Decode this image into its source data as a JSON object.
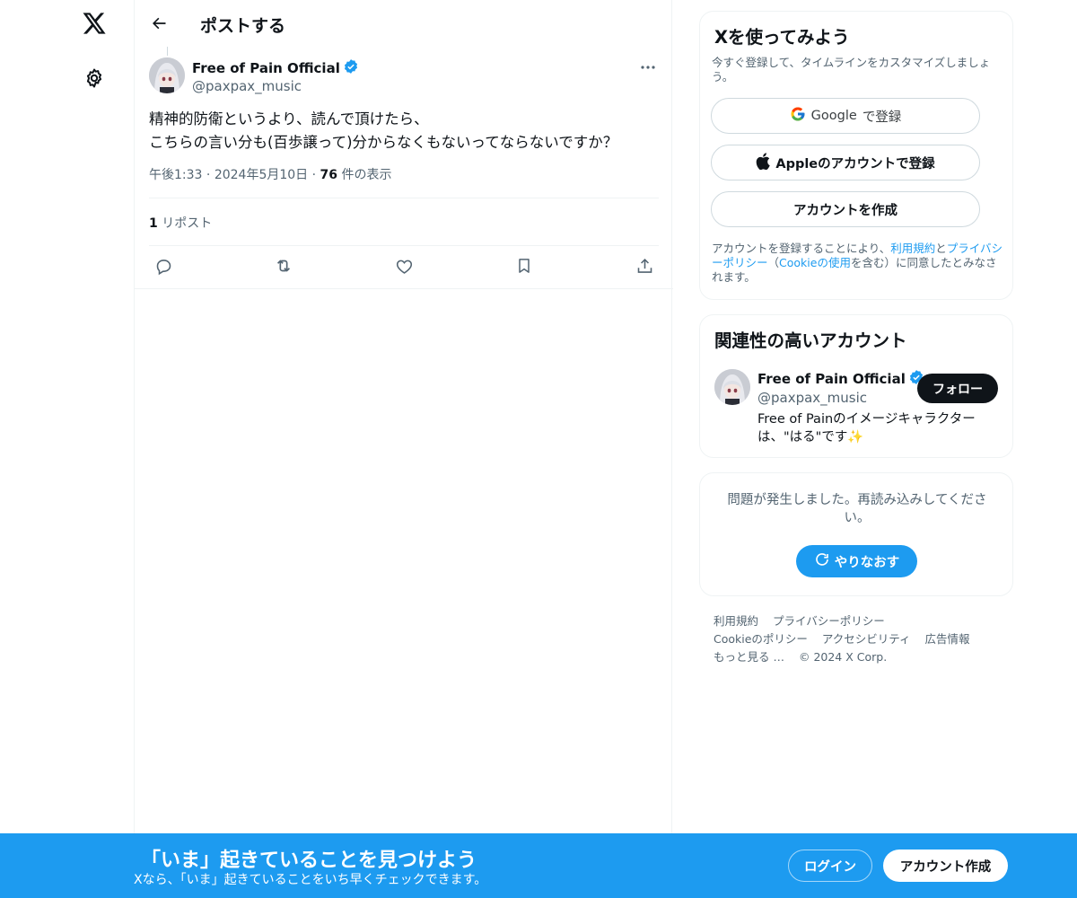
{
  "nav": {
    "logo_icon": "x-logo-icon",
    "settings_icon": "gear-icon"
  },
  "header": {
    "title": "ポストする",
    "back_icon": "arrow-left-icon"
  },
  "post": {
    "author_name": "Free of Pain Official",
    "author_handle": "@paxpax_music",
    "verified": true,
    "body_line1": "精神的防衛というより、読んで頂けたら、",
    "body_line2": "こちらの言い分も(百歩譲って)分からなくもないってならないですか？",
    "time": "午後1:33",
    "date": "2024年5月10日",
    "views_count": "76",
    "views_label": "件の表示",
    "repost_count": "1",
    "repost_label": "リポスト"
  },
  "signup_card": {
    "title": "Xを使ってみよう",
    "subtitle": "今すぐ登録して、タイムラインをカスタマイズしましょう。",
    "google_brand": "Google",
    "google_suffix": "で登録",
    "apple_label": "Appleのアカウントで登録",
    "create_label": "アカウントを作成",
    "terms_prefix": "アカウントを登録することにより、",
    "terms_link": "利用規約",
    "terms_and": "と",
    "privacy_link": "プライバシーポリシー",
    "terms_paren_open": "（",
    "cookie_link": "Cookieの使用",
    "terms_suffix": "を含む）に同意したとみなされます。"
  },
  "related": {
    "title": "関連性の高いアカウント",
    "name": "Free of Pain Official",
    "handle": "@paxpax_music",
    "follow_label": "フォロー",
    "bio": "Free of Painのイメージキャラクターは、\"はる\"です✨"
  },
  "error_card": {
    "message": "問題が発生しました。再読み込みしてください。",
    "retry_label": "やりなおす"
  },
  "footer": {
    "terms": "利用規約",
    "privacy": "プライバシーポリシー",
    "cookie": "Cookieのポリシー",
    "accessibility": "アクセシビリティ",
    "ads": "広告情報",
    "more": "もっと見る …",
    "copyright": "© 2024 X Corp."
  },
  "banner": {
    "title": "「いま」起きていることを見つけよう",
    "subtitle": "Xなら、「いま」起きていることをいち早くチェックできます。",
    "login_label": "ログイン",
    "signup_label": "アカウント作成"
  },
  "colors": {
    "accent": "#1d9bf0",
    "text": "#0f1419",
    "muted": "#536471"
  }
}
